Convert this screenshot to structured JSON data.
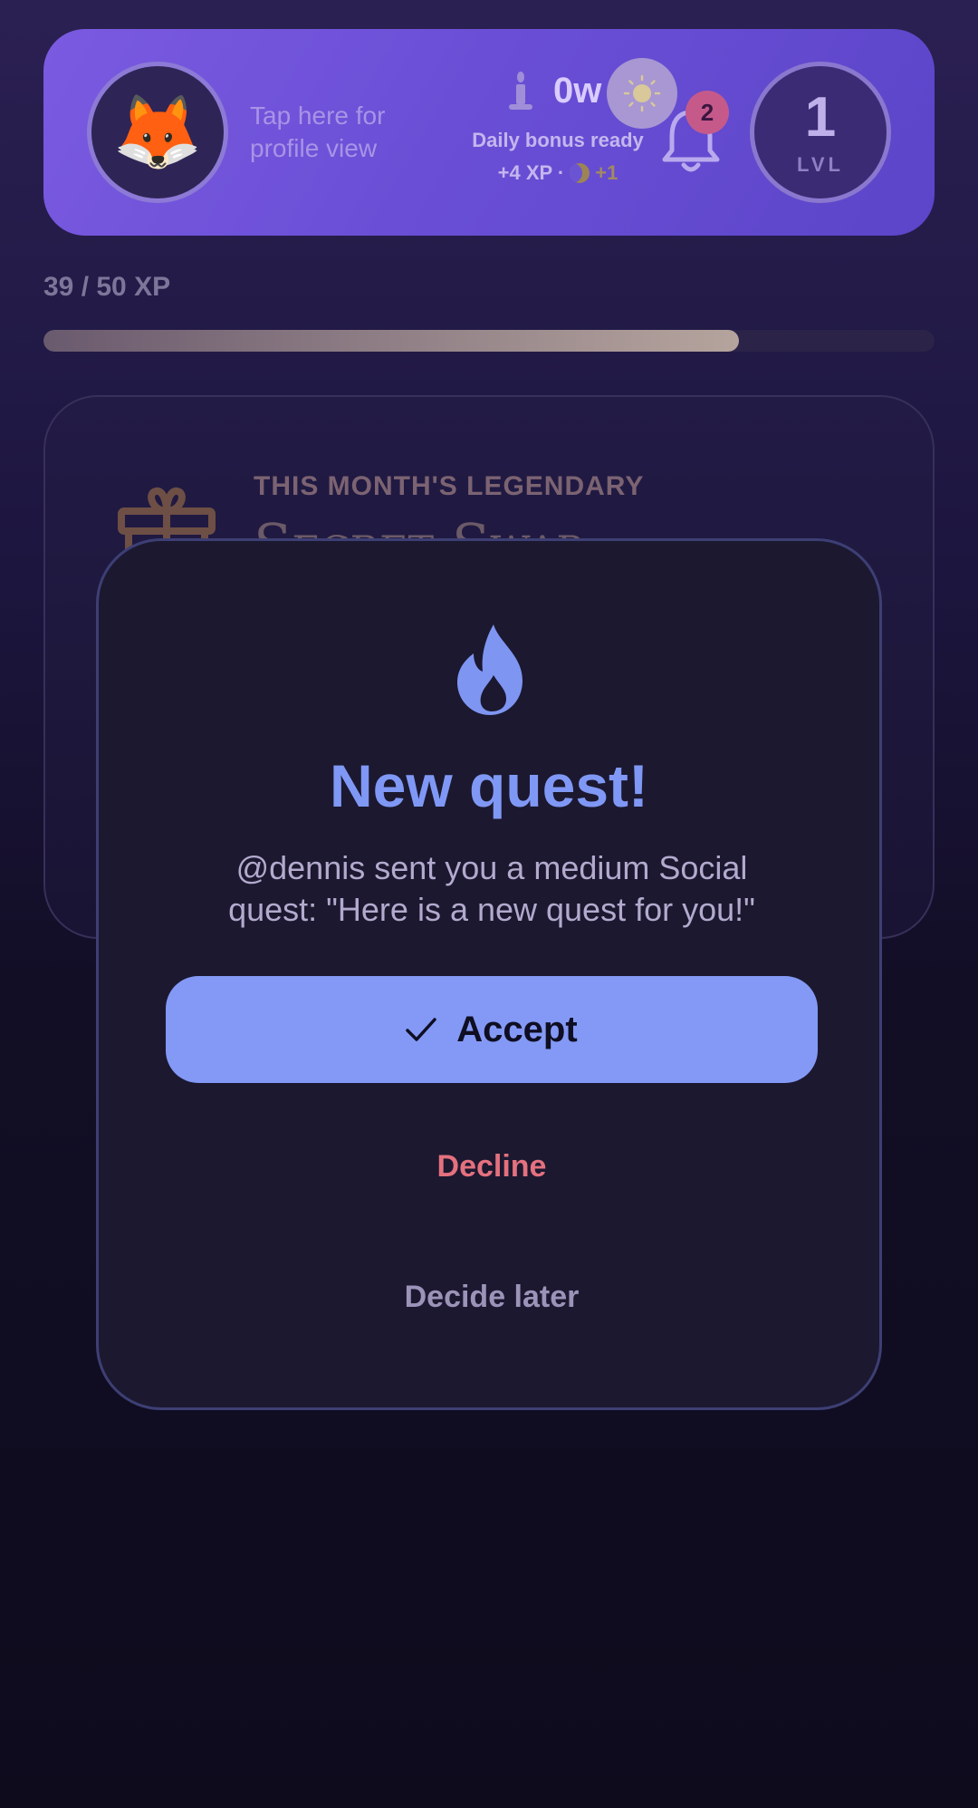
{
  "header": {
    "avatar_emoji": "🦊",
    "profile_hint": "Tap here for profile view",
    "streak": {
      "value": "0w",
      "bonus_status": "Daily bonus ready",
      "bonus_xp": "+4 XP ·",
      "bonus_extra": "+1",
      "icons": [
        "candle-icon",
        "sun-icon",
        "moon-icon"
      ]
    },
    "notifications": {
      "count": "2",
      "icon": "bell-icon"
    },
    "level": {
      "number": "1",
      "label": "LVL"
    }
  },
  "xp": {
    "text": "39 / 50 XP",
    "current": 39,
    "max": 50
  },
  "legendary_card": {
    "eyebrow": "THIS MONTH'S LEGENDARY",
    "title": "Secret Swap",
    "icon": "gift-icon"
  },
  "modal": {
    "icon": "flame-icon",
    "title": "New quest!",
    "message": "@dennis sent you a medium Social quest: \"Here is a new quest for you!\"",
    "accept_label": "Accept",
    "decline_label": "Decline",
    "later_label": "Decide later"
  },
  "colors": {
    "accent": "#8399f5",
    "decline": "#e4717e",
    "header": "#6a4fd6"
  }
}
